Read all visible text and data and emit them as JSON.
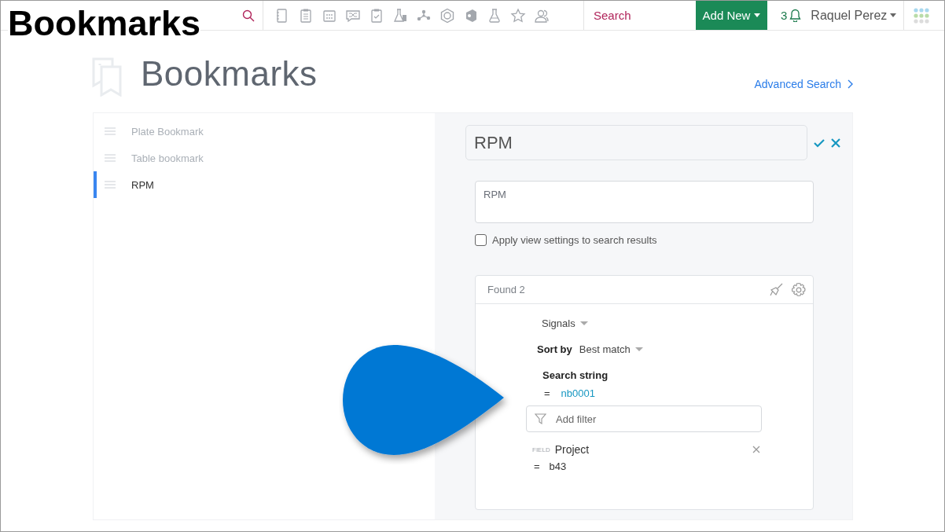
{
  "caption": "Bookmarks",
  "topbar": {
    "search_placeholder": "Search",
    "add_new": "Add New",
    "notifications": "3",
    "user": "Raquel Perez"
  },
  "header": {
    "title": "Bookmarks",
    "advanced_search": "Advanced Search"
  },
  "bookmarks": [
    {
      "label": "Plate Bookmark",
      "selected": false
    },
    {
      "label": "Table bookmark",
      "selected": false
    },
    {
      "label": "RPM",
      "selected": true
    }
  ],
  "editor": {
    "name": "RPM",
    "description": "RPM",
    "apply_view_settings": {
      "label": "Apply view settings to search results",
      "checked": false
    }
  },
  "results": {
    "found": "Found 2",
    "type": "Signals",
    "sort_label": "Sort by",
    "sort_value": "Best match",
    "search_string": {
      "label": "Search string",
      "operator": "=",
      "value": "nb0001"
    },
    "add_filter_placeholder": "Add filter",
    "filters": [
      {
        "tag": "FIELD",
        "name": "Project",
        "operator": "=",
        "value": "b43"
      }
    ]
  }
}
